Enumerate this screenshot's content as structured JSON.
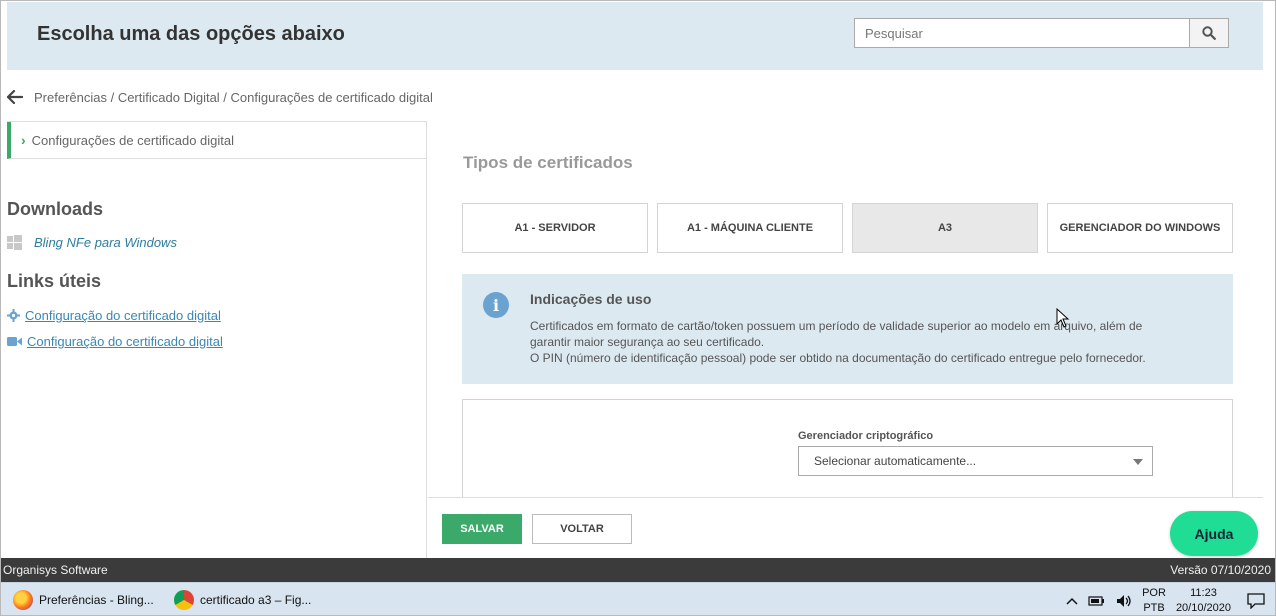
{
  "header": {
    "title": "Escolha uma das opções abaixo",
    "search_placeholder": "Pesquisar"
  },
  "breadcrumb": "Preferências / Certificado Digital / Configurações de certificado digital",
  "sidebar": {
    "active_item": "Configurações de certificado digital",
    "downloads_heading": "Downloads",
    "downloads": [
      {
        "label": "Bling NFe para Windows",
        "icon": "windows-icon"
      }
    ],
    "links_heading": "Links úteis",
    "links": [
      {
        "label": "Configuração do certificado digital",
        "icon": "gear-icon"
      },
      {
        "label": "Configuração do certificado digital",
        "icon": "video-icon"
      }
    ]
  },
  "main": {
    "title": "Tipos de certificados",
    "tabs": [
      {
        "label": "A1 - SERVIDOR",
        "active": false
      },
      {
        "label": "A1 - MÁQUINA CLIENTE",
        "active": false
      },
      {
        "label": "A3",
        "active": true
      },
      {
        "label": "GERENCIADOR DO WINDOWS",
        "active": false
      }
    ],
    "info": {
      "heading": "Indicações de uso",
      "line1": "Certificados em formato de cartão/token possuem um período de validade superior ao modelo em arquivo, além de",
      "line2": "garantir maior segurança ao seu certificado.",
      "line3": "O PIN (número de identificação pessoal) pode ser obtido na documentação do certificado entregue pelo fornecedor."
    },
    "crypto_manager": {
      "label": "Gerenciador criptográfico",
      "value": "Selecionar automaticamente..."
    }
  },
  "actions": {
    "save": "SALVAR",
    "back": "VOLTAR",
    "help": "Ajuda"
  },
  "statusbar": {
    "left": "Organisys Software",
    "right": "Versão 07/10/2020"
  },
  "taskbar": {
    "items": [
      {
        "label": "Preferências - Bling...",
        "icon": "firefox-icon"
      },
      {
        "label": "certificado a3 – Fig...",
        "icon": "chrome-icon"
      }
    ],
    "lang_top": "POR",
    "lang_bottom": "PTB",
    "time": "11:23",
    "date": "20/10/2020"
  },
  "colors": {
    "accent_green": "#3aa96a",
    "header_bg": "#dde9f1",
    "help_button": "#1fdd94"
  }
}
